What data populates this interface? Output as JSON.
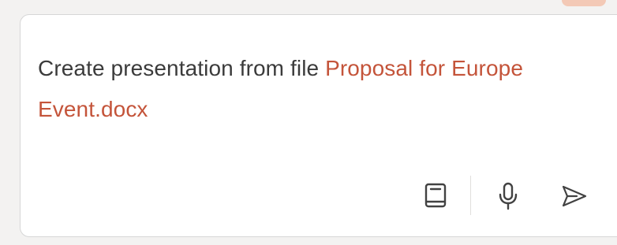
{
  "composer": {
    "prompt_prefix": "Create presentation from file ",
    "file_reference": "Proposal for Europe Event.docx"
  },
  "toolbar": {
    "buttons": [
      {
        "icon": "notebook-icon"
      },
      {
        "icon": "microphone-icon"
      },
      {
        "icon": "send-icon"
      }
    ]
  },
  "colors": {
    "accent": "#c4543a",
    "text": "#3b3b3b",
    "icon": "#424242",
    "border": "#d6d6d6",
    "background": "#f3f2f1"
  }
}
